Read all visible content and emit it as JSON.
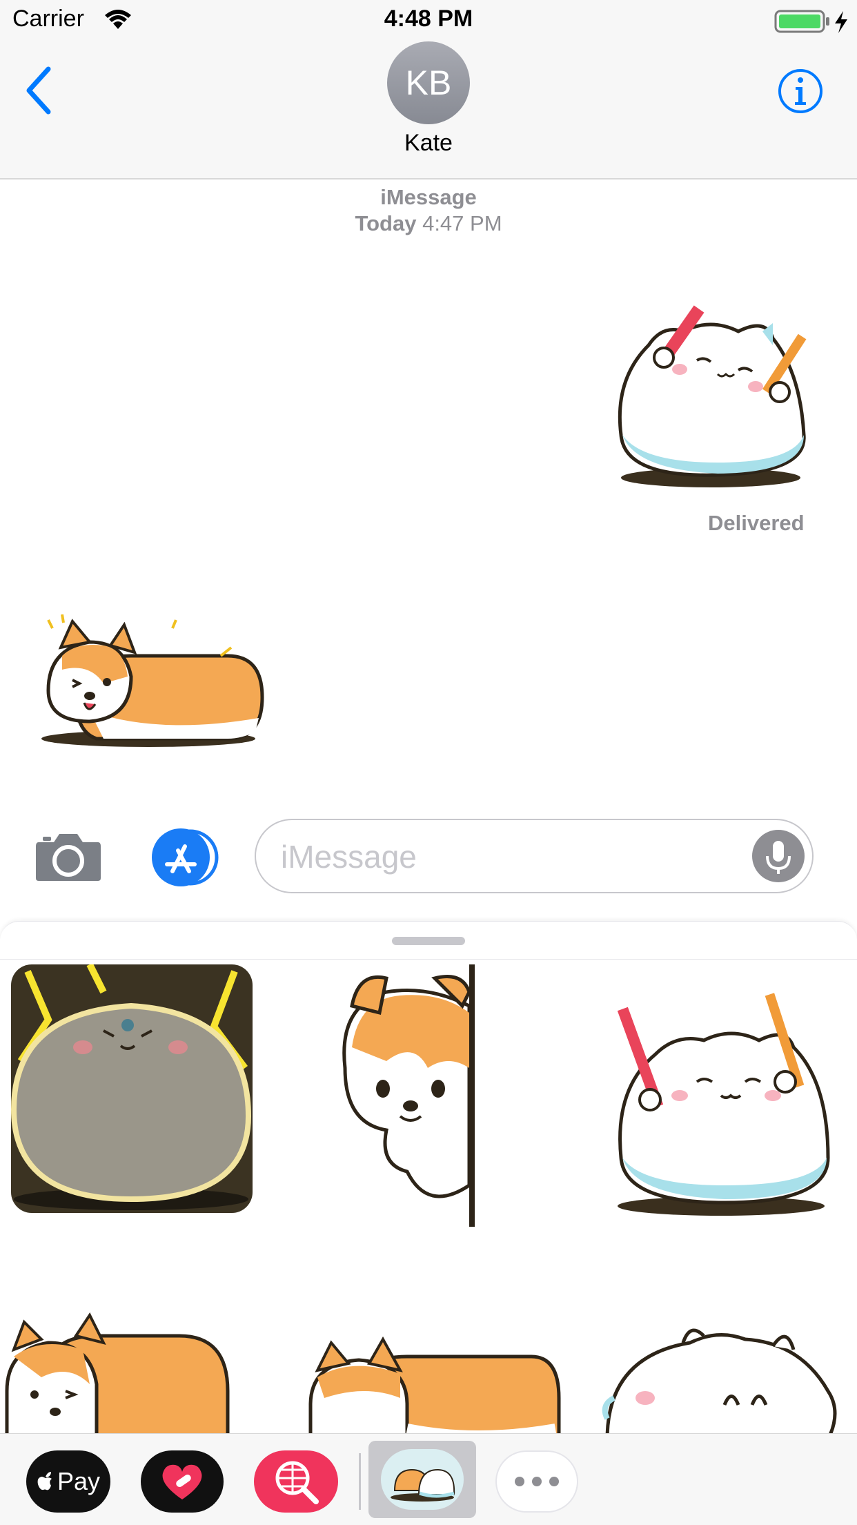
{
  "status_bar": {
    "carrier": "Carrier",
    "time": "4:48 PM"
  },
  "header": {
    "avatar_initials": "KB",
    "contact_name": "Kate"
  },
  "conversation": {
    "service": "iMessage",
    "day": "Today",
    "time": "4:47 PM",
    "delivered": "Delivered",
    "messages": [
      {
        "from": "me",
        "content": "cat-sticker-with-sticks"
      },
      {
        "from": "them",
        "content": "corgi-stretching-sticker"
      }
    ]
  },
  "input": {
    "placeholder": "iMessage"
  },
  "sticker_drawer": {
    "stickers": [
      "gray-cat-lightning",
      "corgi-peeking",
      "white-cat-sticks",
      "corgi-wink",
      "corgi-lying",
      "white-cat-peek"
    ]
  },
  "app_strip": {
    "apple_pay_label": "Pay"
  },
  "colors": {
    "ios_blue": "#007aff",
    "battery_green": "#4cd964",
    "corgi_orange": "#f4a853",
    "cat_blue": "#a8e0ea",
    "search_red": "#f0345c"
  }
}
